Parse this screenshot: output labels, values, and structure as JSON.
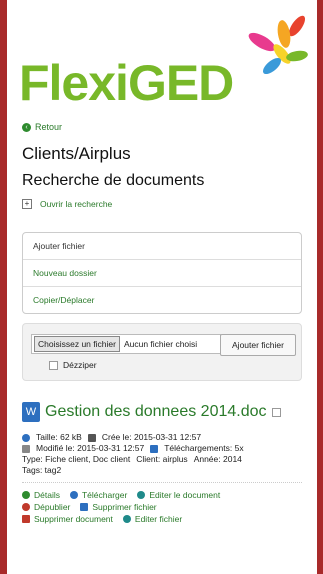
{
  "brand": {
    "logo_text": "FlexiGED"
  },
  "nav": {
    "back_label": "Retour"
  },
  "page": {
    "title": "Clients/Airplus",
    "subtitle": "Recherche de documents"
  },
  "search": {
    "open_label": "Ouvrir la recherche"
  },
  "menu": {
    "items": [
      "Ajouter fichier",
      "Nouveau dossier",
      "Copier/Déplacer"
    ]
  },
  "upload": {
    "choose_label": "Choisissez un fichier",
    "no_file_label": "Aucun fichier choisi",
    "add_label": "Ajouter fichier",
    "unzip_label": "Dézziper"
  },
  "document": {
    "title": "Gestion des donnees 2014.doc",
    "size": "Taille: 62 kB",
    "created": "Crée le: 2015-03-31 12:57",
    "modified": "Modifié le: 2015-03-31 12:57",
    "downloads": "Téléchargements: 5x",
    "type": "Type: Fiche client, Doc client",
    "client": "Client: airplus",
    "year": "Année: 2014",
    "tags": "Tags: tag2"
  },
  "actions": {
    "details": "Détails",
    "download": "Télécharger",
    "edit_doc": "Editer le document",
    "unpublish": "Dépublier",
    "delete_file": "Supprimer fichier",
    "delete_doc": "Supprimer document",
    "edit_file": "Editer fichier"
  },
  "colors": {
    "brand_green": "#78b829",
    "link_green": "#2a7a2a",
    "frame_red": "#a82a2a"
  }
}
